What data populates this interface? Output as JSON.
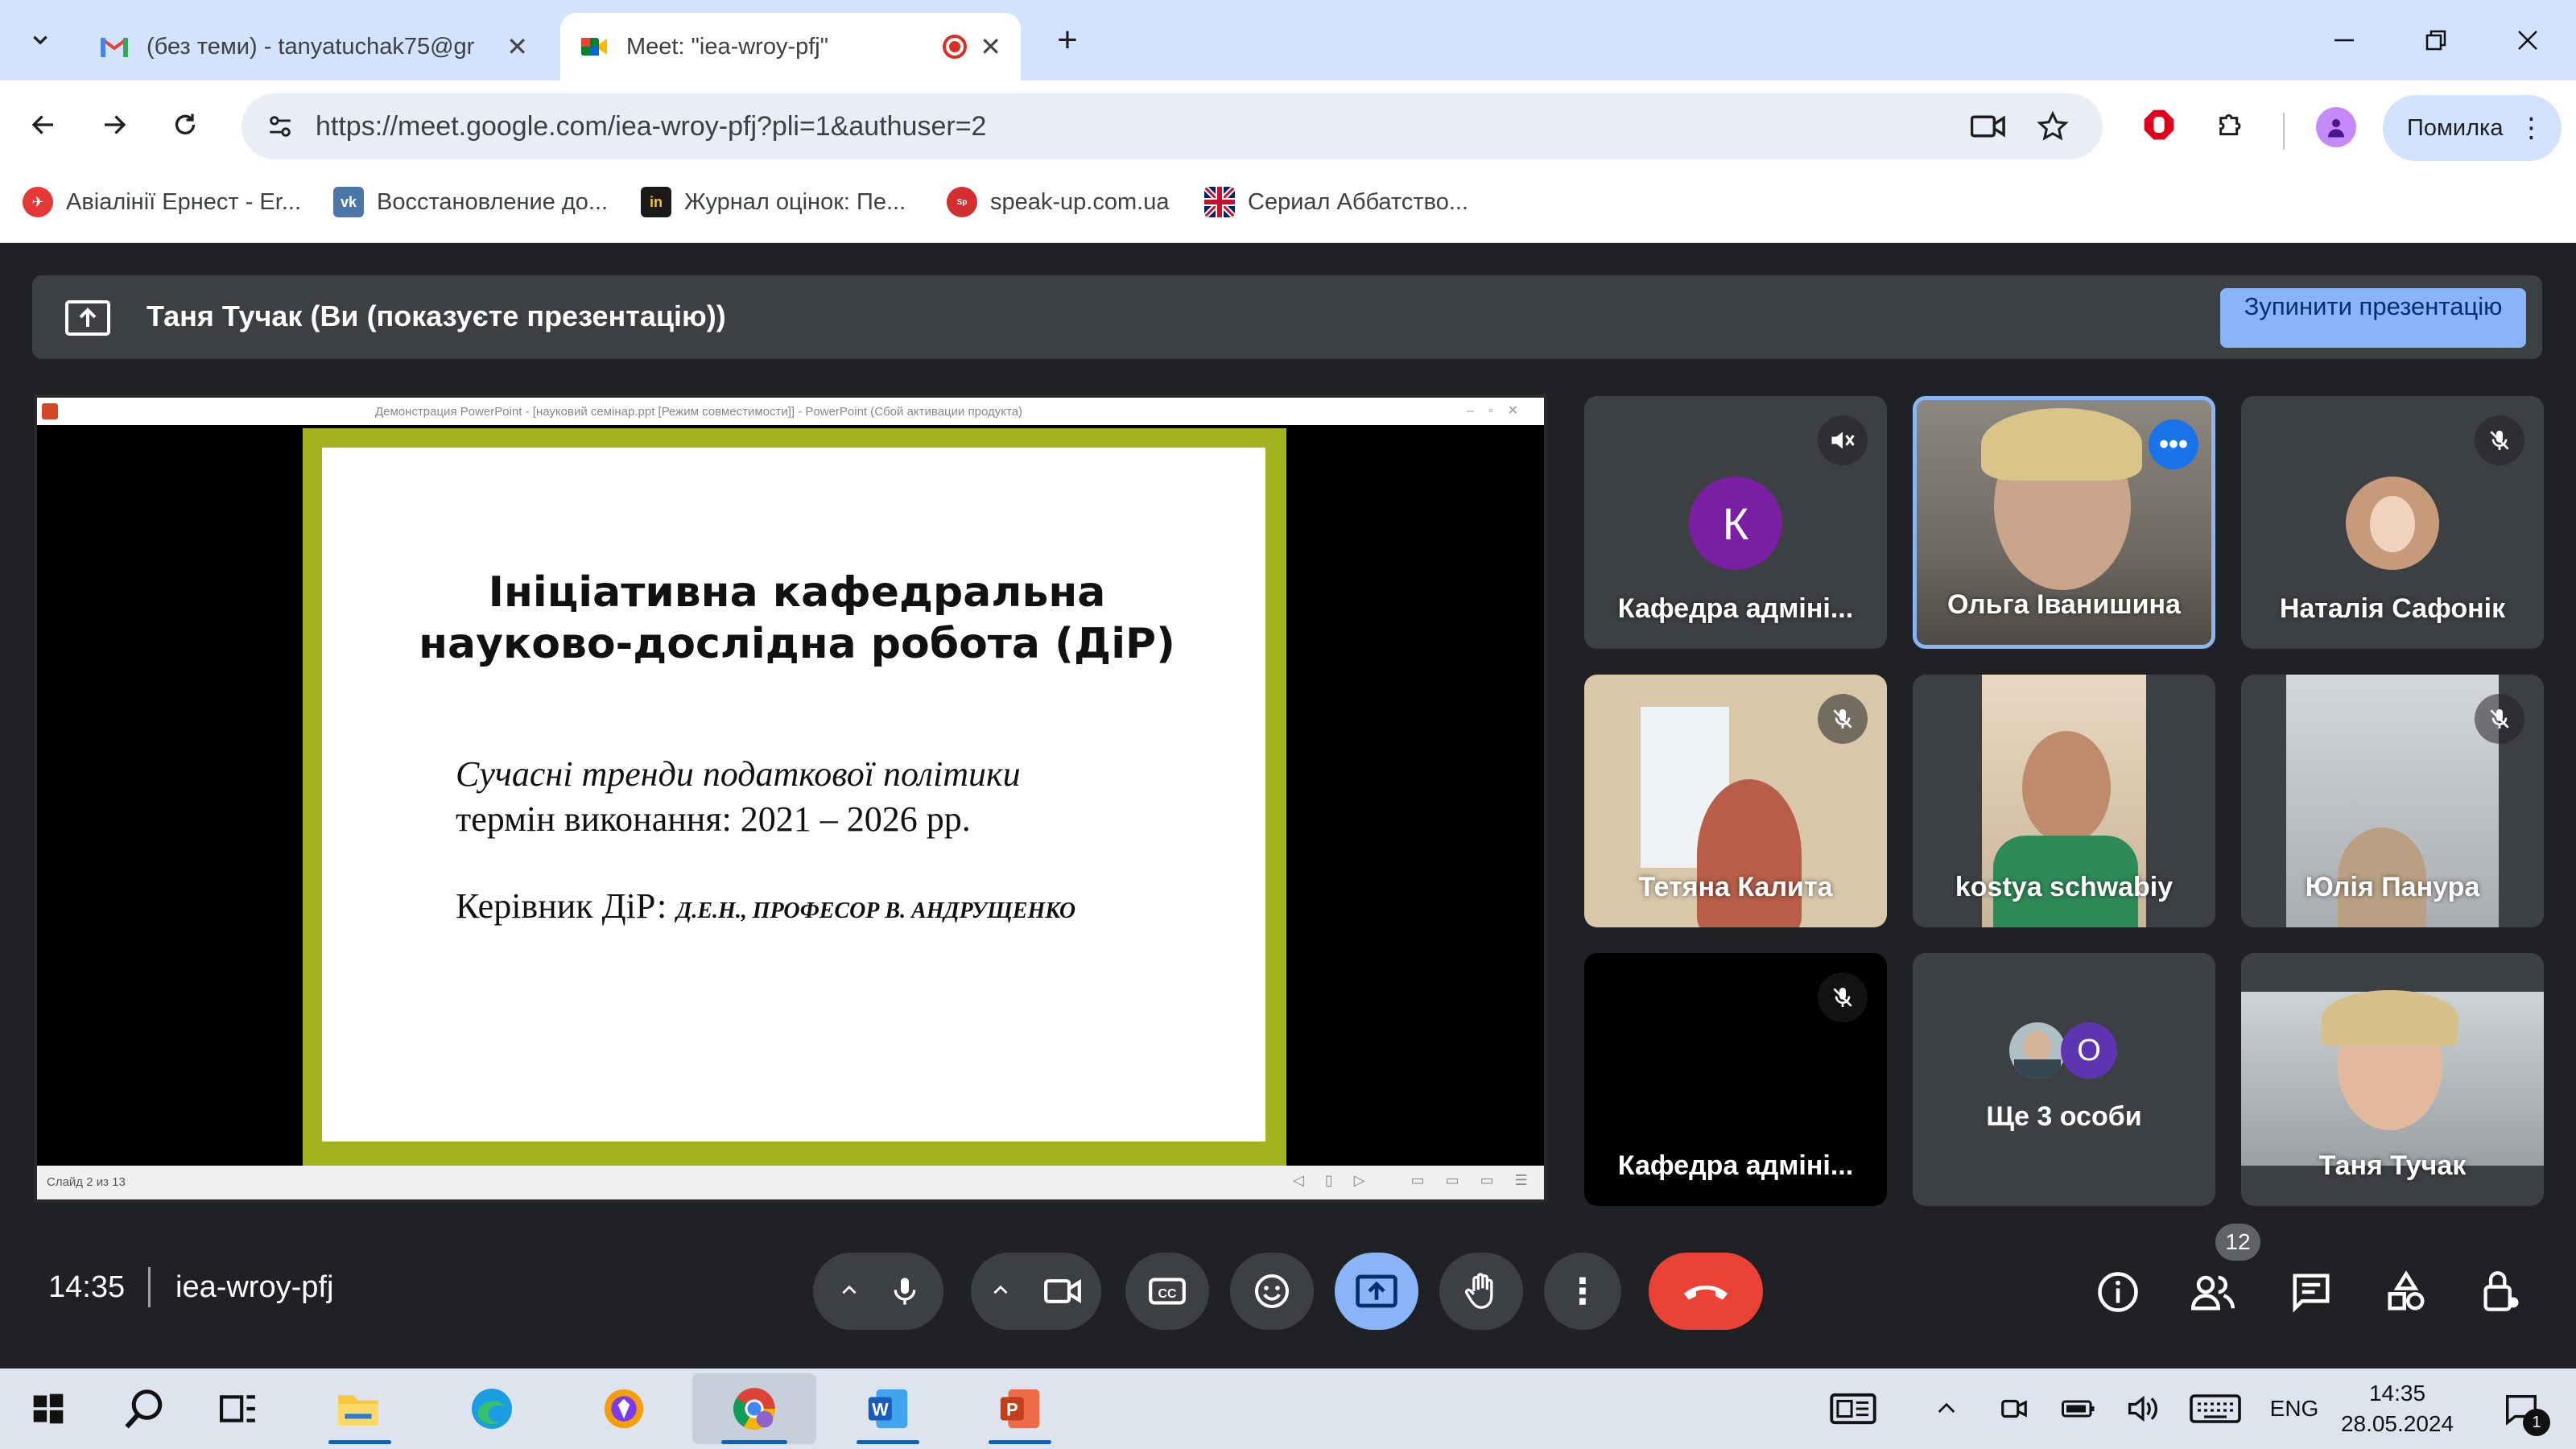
{
  "browser": {
    "tabs": [
      {
        "title": "(без теми) - tanyatuchak75@gr"
      },
      {
        "title": "Meet: \"iea-wroy-pfj\""
      }
    ],
    "url": "https://meet.google.com/iea-wroy-pfj?pli=1&authuser=2",
    "profile_label": "Помилка",
    "bookmarks": [
      {
        "label": "Авіалінії Ернест - Er..."
      },
      {
        "label": "Восстановление до..."
      },
      {
        "label": "Журнал оцінок: Пе..."
      },
      {
        "label": "speak-up.com.ua"
      },
      {
        "label": "Сериал Аббатство..."
      }
    ]
  },
  "meet": {
    "presenter_banner": "Таня Тучак (Ви (показуєте презентацію))",
    "stop_presenting": "Зупинити презентацію",
    "time": "14:35",
    "meeting_code": "iea-wroy-pfj",
    "people_count": "12",
    "participants": [
      {
        "name": "Кафедра адміні...",
        "initial": "К",
        "avatar_color": "#7b1fa2"
      },
      {
        "name": "Ольга Іванишина"
      },
      {
        "name": "Наталія Сафонік"
      },
      {
        "name": "Тетяна Калита"
      },
      {
        "name": "kostya schwabiy"
      },
      {
        "name": "Юлія Панура"
      },
      {
        "name": "Кафедра адміні..."
      },
      {
        "name": "Ще 3 особи",
        "initial": "О"
      },
      {
        "name": "Таня Тучак"
      }
    ]
  },
  "slide": {
    "window_title": "Демонстрация PowerPoint - [науковий семінар.ppt [Режим совместимости]] - PowerPoint (Сбой активации продукта)",
    "title": "Ініціативна кафедральна науково-дослідна робота (ДіР)",
    "subtitle": "Сучасні тренди податкової політики",
    "term": "термін виконання: 2021 – 2026 рр.",
    "leader_label": "Керівник ДіР:",
    "leader_name": "Д.Е.Н., ПРОФЕСОР В. АНДРУЩЕНКО",
    "status": "Слайд 2 из 13"
  },
  "taskbar": {
    "lang": "ENG",
    "time": "14:35",
    "date": "28.05.2024",
    "notifications": "1"
  },
  "colors": {
    "tab_strip": "#d3e3fd",
    "meet_bg": "#202124",
    "tile_bg": "#3c4043",
    "end_call": "#ea4335",
    "accent": "#8ab4f8",
    "slide_border": "#a3b31e"
  }
}
